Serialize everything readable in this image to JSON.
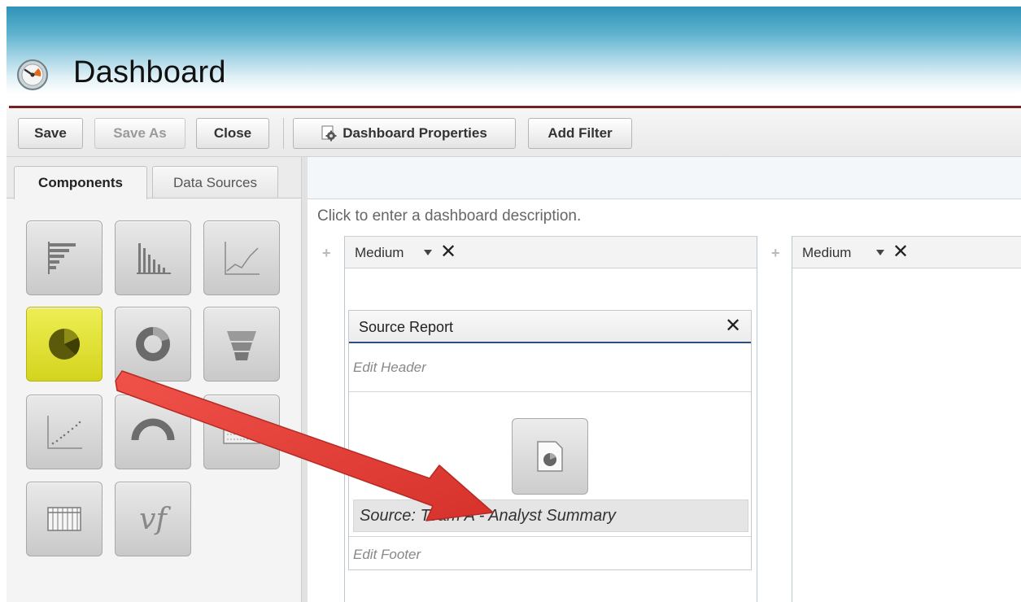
{
  "header": {
    "title": "Dashboard",
    "logo_icon": "dashboard-gauge-icon"
  },
  "toolbar": {
    "save_label": "Save",
    "save_as_label": "Save As",
    "close_label": "Close",
    "properties_label": "Dashboard Properties",
    "add_filter_label": "Add Filter"
  },
  "sidebar": {
    "tabs": [
      {
        "label": "Components",
        "active": true
      },
      {
        "label": "Data Sources",
        "active": false
      }
    ],
    "components": [
      {
        "name": "horizontal-bar-chart",
        "icon": "horizontal-bar-chart-icon",
        "selected": false
      },
      {
        "name": "vertical-column-chart",
        "icon": "vertical-column-chart-icon",
        "selected": false
      },
      {
        "name": "line-chart",
        "icon": "line-chart-icon",
        "selected": false
      },
      {
        "name": "pie-chart",
        "icon": "pie-chart-icon",
        "selected": true
      },
      {
        "name": "donut-chart",
        "icon": "donut-chart-icon",
        "selected": false
      },
      {
        "name": "funnel-chart",
        "icon": "funnel-chart-icon",
        "selected": false
      },
      {
        "name": "scatter-chart",
        "icon": "scatter-chart-icon",
        "selected": false
      },
      {
        "name": "gauge",
        "icon": "gauge-icon",
        "selected": false
      },
      {
        "name": "metric",
        "icon": "metric-icon",
        "selected": false
      },
      {
        "name": "table",
        "icon": "table-icon",
        "selected": false
      },
      {
        "name": "visualforce-page",
        "icon": "visualforce-icon",
        "label": "vf",
        "selected": false
      }
    ]
  },
  "main": {
    "description": "Click to enter a dashboard description.",
    "columns": [
      {
        "size": "Medium"
      },
      {
        "size": "Medium"
      }
    ],
    "card": {
      "title": "Source Report",
      "edit_header": "Edit Header",
      "source": "Source: Team A - Analyst Summary",
      "edit_footer": "Edit Footer"
    }
  },
  "colors": {
    "header_line": "#7a1f1f",
    "selected_component": "#d4d41e",
    "arrow": "#e8403a"
  }
}
